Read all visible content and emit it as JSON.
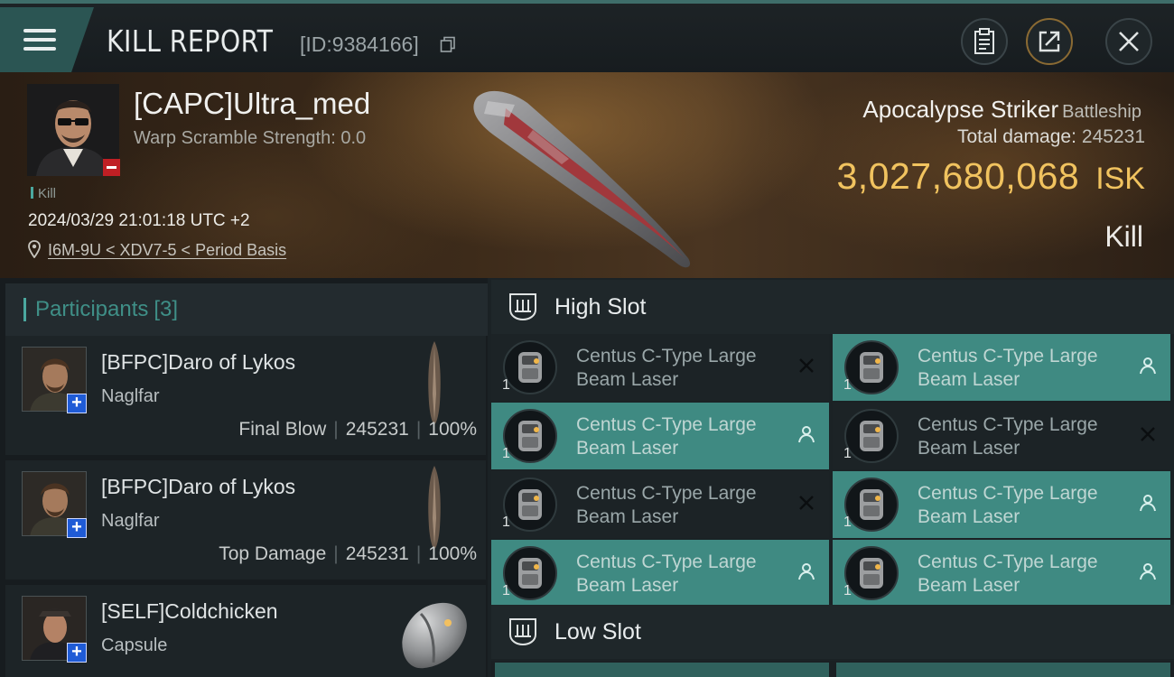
{
  "header": {
    "title": "KILL REPORT",
    "report_id": "[ID:9384166]"
  },
  "victim": {
    "name": "[CAPC]Ultra_med",
    "warp_scramble": "Warp Scramble Strength: 0.0",
    "tag": "Kill",
    "datetime": "2024/03/29 21:01:18 UTC +2",
    "location": "I6M-9U < XDV7-5 < Period Basis"
  },
  "ship": {
    "name": "Apocalypse Striker",
    "class": "Battleship",
    "total_damage_label": "Total damage:",
    "total_damage": "245231",
    "isk_value": "3,027,680,068",
    "isk_unit": "ISK",
    "outcome": "Kill"
  },
  "participants": {
    "title": "Participants",
    "count": "[3]",
    "items": [
      {
        "name": "[BFPC]Daro of Lykos",
        "ship": "Naglfar",
        "role": "Final Blow",
        "damage": "245231",
        "percent": "100%"
      },
      {
        "name": "[BFPC]Daro of Lykos",
        "ship": "Naglfar",
        "role": "Top Damage",
        "damage": "245231",
        "percent": "100%"
      },
      {
        "name": "[SELF]Coldchicken",
        "ship": "Capsule"
      }
    ]
  },
  "slots": {
    "high_title": "High Slot",
    "low_title": "Low Slot",
    "high_modules": [
      {
        "name": "Centus C-Type Large Beam Laser",
        "qty": "1",
        "state": "destroyed"
      },
      {
        "name": "Centus C-Type Large Beam Laser",
        "qty": "1",
        "state": "dropped"
      },
      {
        "name": "Centus C-Type Large Beam Laser",
        "qty": "1",
        "state": "dropped"
      },
      {
        "name": "Centus C-Type Large Beam Laser",
        "qty": "1",
        "state": "destroyed"
      },
      {
        "name": "Centus C-Type Large Beam Laser",
        "qty": "1",
        "state": "destroyed"
      },
      {
        "name": "Centus C-Type Large Beam Laser",
        "qty": "1",
        "state": "dropped"
      },
      {
        "name": "Centus C-Type Large Beam Laser",
        "qty": "1",
        "state": "dropped"
      },
      {
        "name": "Centus C-Type Large Beam Laser",
        "qty": "1",
        "state": "dropped"
      }
    ]
  },
  "icons": {
    "menu": "menu-icon",
    "copy": "copy-icon",
    "clipboard": "clipboard-icon",
    "share": "share-icon",
    "close": "close-icon",
    "location": "location-pin-icon",
    "slot": "high-slot-icon",
    "destroyed": "x-icon",
    "dropped": "person-icon"
  },
  "colors": {
    "accent": "#3f8a82",
    "isk": "#f1c35f",
    "victim_status": "#c01f24",
    "participant_badge": "#1f5bd6"
  }
}
